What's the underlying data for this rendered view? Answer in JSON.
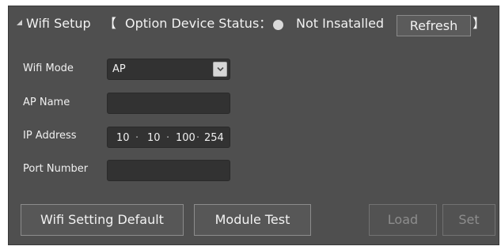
{
  "header": {
    "title": "Wifi Setup",
    "bracket_open": "【",
    "status_label": "Option Device Status：",
    "status_value": "Not Insatalled",
    "refresh_label": "Refresh",
    "bracket_close": "】"
  },
  "form": {
    "wifi_mode_label": "Wifi Mode",
    "wifi_mode_value": "AP",
    "ap_name_label": "AP Name",
    "ap_name_value": "",
    "ip_address_label": "IP Address",
    "ip_address": [
      "10",
      "10",
      "100",
      "254"
    ],
    "ip_separator": "·",
    "port_number_label": "Port Number",
    "port_number_value": ""
  },
  "buttons": {
    "wifi_default": "Wifi Setting Default",
    "module_test": "Module Test",
    "load": "Load",
    "set": "Set"
  },
  "colors": {
    "panel_bg": "#4f4f4f",
    "field_bg": "#323232",
    "status_dot": "#d9d9d9",
    "disabled_text": "#8d8d8d"
  },
  "icons": {
    "collapse": "collapse-triangle-icon",
    "dropdown": "chevron-down-icon",
    "status": "status-dot-icon"
  }
}
